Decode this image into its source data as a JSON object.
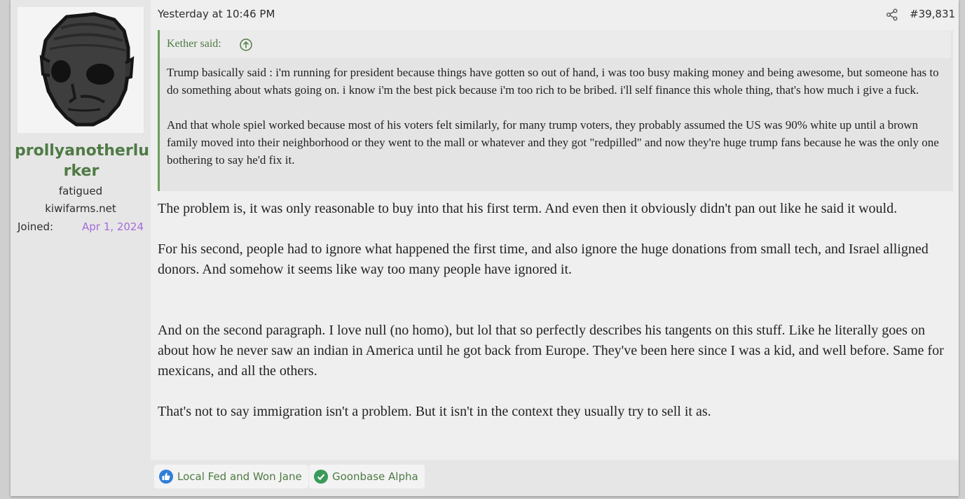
{
  "user": {
    "name": "prollyanotherlurker",
    "name_line1": "prollyanotherlu",
    "name_line2": "rker",
    "title": "fatigued",
    "banner": "kiwifarms.net",
    "joined_label": "Joined:",
    "joined_value": "Apr 1, 2024"
  },
  "header": {
    "date": "Yesterday at 10:46 PM",
    "post_number": "#39,831"
  },
  "quote": {
    "author": "Kether said:",
    "paragraphs": [
      "Trump basically said : i'm running for president because things have gotten so out of hand, i was too busy making money and being awesome, but someone has to do something about whats going on. i know i'm the best pick because i'm too rich to be bribed. i'll self finance this whole thing, that's how much i give a fuck.",
      "And that whole spiel worked because most of his voters felt similarly, for many trump voters, they probably assumed the US was 90% white up until a brown family moved into their neighborhood or they went to the mall or whatever and they got \"redpilled\" and now they're huge trump fans because he was the only one bothering to say he'd fix it."
    ]
  },
  "message": {
    "paragraphs": [
      "The problem is, it was only reasonable to buy into that his first term. And even then it obviously didn't pan out like he said it would.",
      "For his second, people had to ignore what happened the first time, and also ignore the huge donations from small tech, and Israel alligned donors. And somehow it seems like way too many people have ignored it.",
      "And on the second paragraph. I love null (no homo), but lol that so perfectly describes his tangents on this stuff. Like he literally goes on about how he never saw an indian in America until he got back from Europe. They've been here since I was a kid, and well before. Same for mexicans, and all the others.",
      "That's not to say immigration isn't a problem. But it isn't in the context they usually try to sell it as."
    ]
  },
  "reactions": [
    {
      "label": "Local Fed and Won Jane",
      "icon": "thumbs-up-icon",
      "color": "#2f7fd8"
    },
    {
      "label": "Goonbase Alpha",
      "icon": "check-circle-icon",
      "color": "#3a9a5b"
    }
  ],
  "colors": {
    "accent_green": "#4f7a45",
    "joined_purple": "#a56bd8",
    "quote_border": "#6c9f5f"
  }
}
